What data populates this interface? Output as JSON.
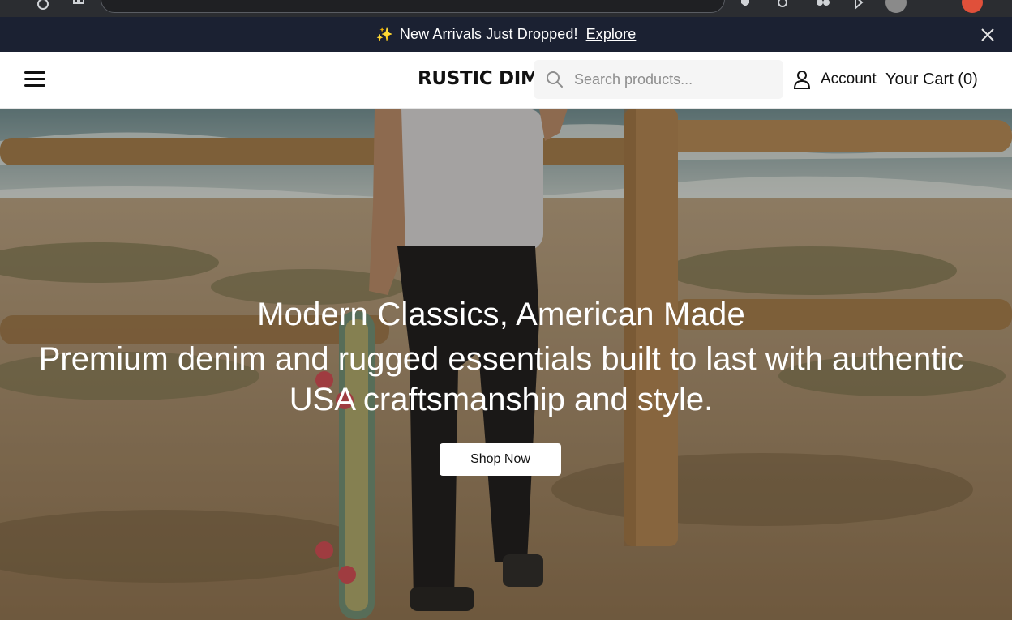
{
  "announcement": {
    "text": "New Arrivals Just Dropped!",
    "link": "Explore",
    "sparkle": "✨"
  },
  "header": {
    "logo": "RUSTIC DIM",
    "search_placeholder": "Search products...",
    "account_label": "Account",
    "cart_label": "Your Cart (0)"
  },
  "hero": {
    "title": "Modern Classics, American Made",
    "subtitle": "Premium denim and rugged essentials built to last with authentic USA craftsmanship and style.",
    "cta": "Shop Now"
  },
  "icons": {
    "menu": "hamburger-menu-icon",
    "search": "search-icon",
    "account": "user-icon",
    "close": "close-icon"
  },
  "colors": {
    "announce_bg": "#1b2132",
    "header_bg": "#ffffff",
    "hero_text": "#ffffff",
    "button_bg": "#ffffff"
  }
}
